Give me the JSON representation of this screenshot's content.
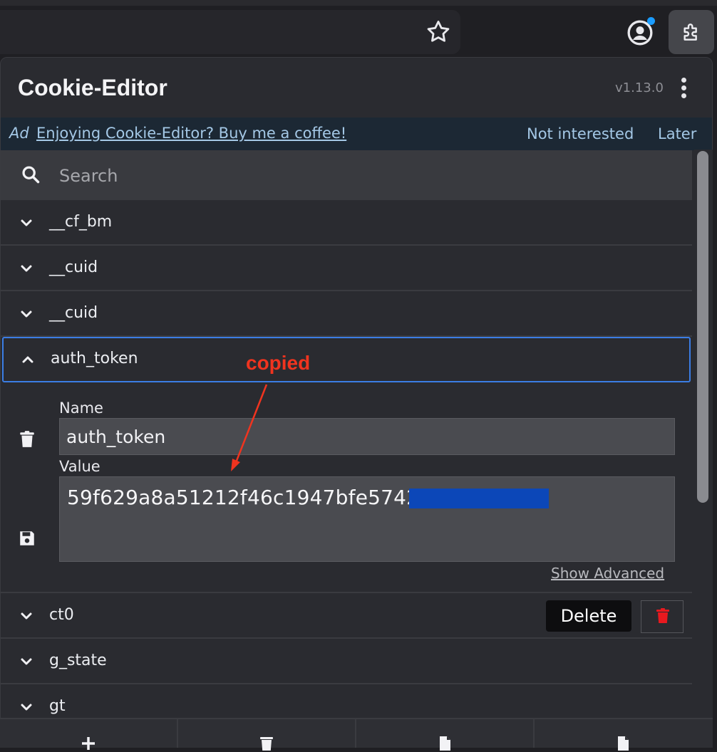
{
  "header": {
    "title": "Cookie-Editor",
    "version": "v1.13.0"
  },
  "ad": {
    "label": "Ad",
    "link": "Enjoying Cookie-Editor? Buy me a coffee!",
    "not_interested": "Not interested",
    "later": "Later"
  },
  "search": {
    "placeholder": "Search"
  },
  "cookies": [
    {
      "name": "__cf_bm"
    },
    {
      "name": "__cuid"
    },
    {
      "name": "__cuid"
    },
    {
      "name": "auth_token"
    },
    {
      "name": "ct0"
    },
    {
      "name": "g_state"
    },
    {
      "name": "gt"
    }
  ],
  "detail": {
    "name_label": "Name",
    "name_value": "auth_token",
    "value_label": "Value",
    "value_text": "59f629a8a51212f46c1947bfe5742",
    "show_advanced": "Show Advanced"
  },
  "row_actions": {
    "delete_label": "Delete"
  },
  "annotation": {
    "text": "copied",
    "color": "#f0341f"
  },
  "colors": {
    "accent": "#3b7de4",
    "danger": "#e8191f",
    "ad_bg": "#1c2834",
    "redaction": "#0c47b8"
  },
  "icons": [
    "star-icon",
    "profile-icon",
    "extension-puzzle-icon",
    "kebab-menu-icon",
    "search-icon",
    "chevron-down-icon",
    "chevron-up-icon",
    "trash-icon",
    "save-icon",
    "add-icon",
    "file-icon"
  ]
}
